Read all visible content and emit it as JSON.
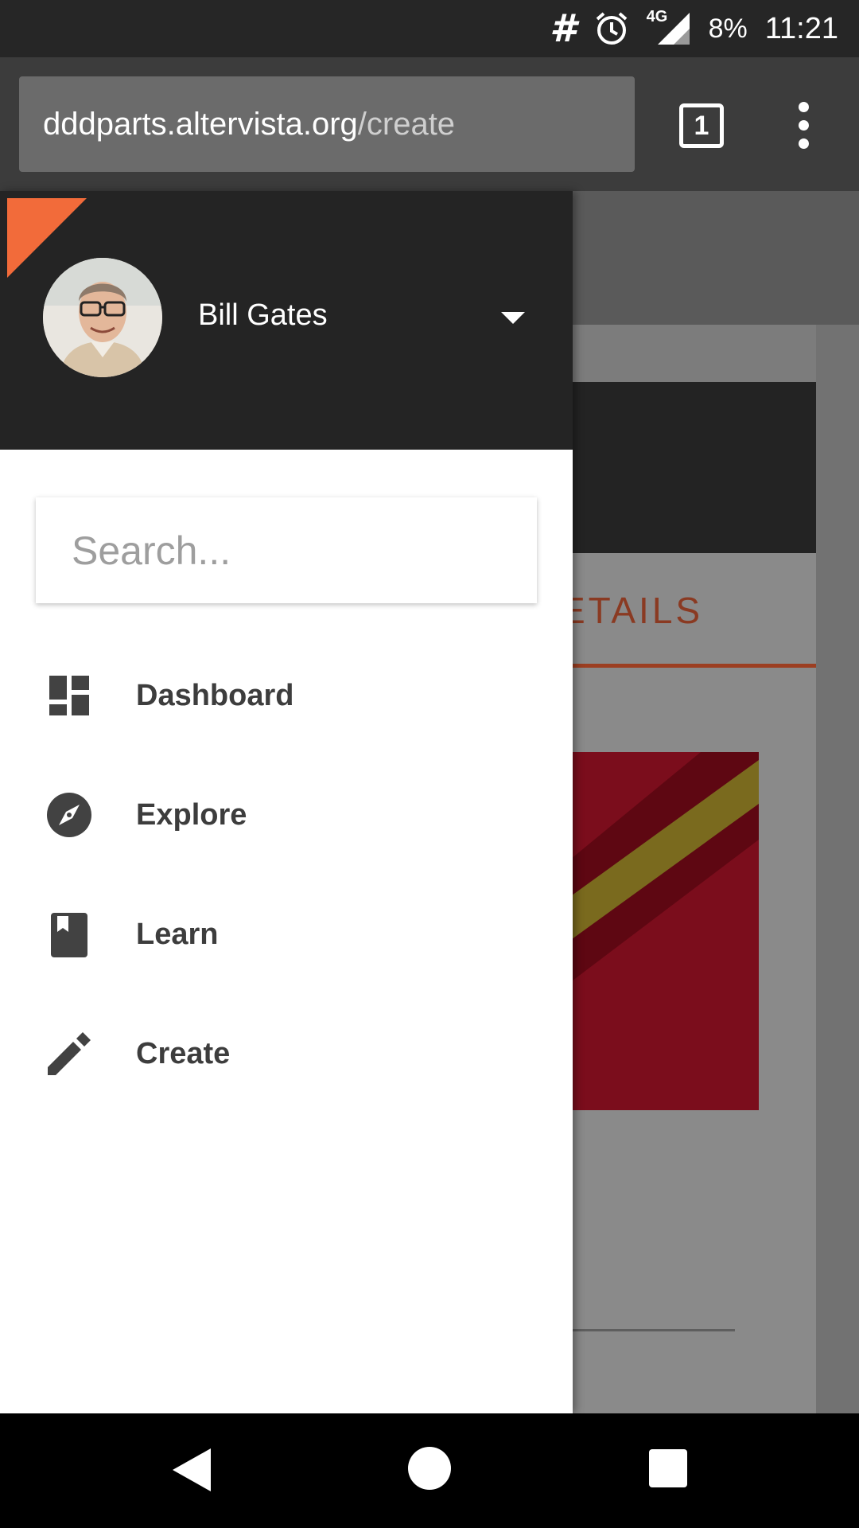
{
  "status_bar": {
    "hash_glyph": "#",
    "network": "4G",
    "battery": "8%",
    "time": "11:21",
    "icons": [
      "hash-icon",
      "alarm-icon",
      "signal-icon"
    ]
  },
  "browser": {
    "url_domain": "dddparts.altervista.org",
    "url_path": "/create",
    "tab_count": "1",
    "icons": [
      "tabs-icon",
      "overflow-menu-icon"
    ]
  },
  "background_page": {
    "tab_text": "ETAILS"
  },
  "drawer": {
    "accent_color": "#f26b3a",
    "user": {
      "name": "Bill Gates"
    },
    "search": {
      "placeholder": "Search..."
    },
    "items": [
      {
        "label": "Dashboard",
        "icon": "dashboard-icon"
      },
      {
        "label": "Explore",
        "icon": "compass-icon"
      },
      {
        "label": "Learn",
        "icon": "book-icon"
      },
      {
        "label": "Create",
        "icon": "pencil-icon"
      }
    ]
  },
  "system_nav": {
    "icons": [
      "back-icon",
      "home-icon",
      "recents-icon"
    ]
  }
}
